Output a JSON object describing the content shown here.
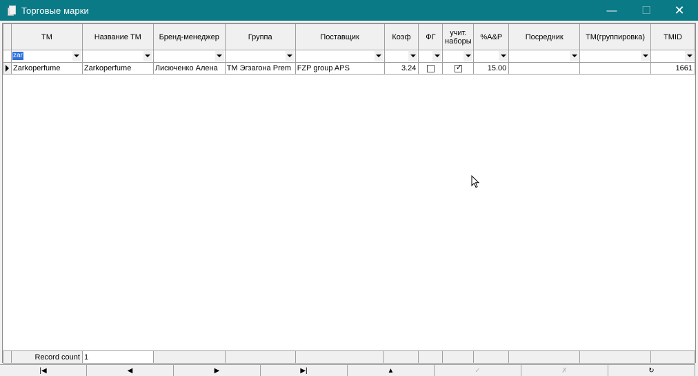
{
  "window": {
    "title": "Торговые марки",
    "minimize_glyph": "—",
    "maximize_glyph": "☐",
    "close_glyph": "✕"
  },
  "grid": {
    "columns": [
      {
        "key": "tm",
        "label": "ТМ"
      },
      {
        "key": "name_tm",
        "label": "Название ТМ"
      },
      {
        "key": "brand_manager",
        "label": "Бренд-менеджер"
      },
      {
        "key": "group",
        "label": "Группа"
      },
      {
        "key": "supplier",
        "label": "Поставщик"
      },
      {
        "key": "coef",
        "label": "Коэф"
      },
      {
        "key": "fg",
        "label": "ФГ"
      },
      {
        "key": "sets",
        "label": "учит. наборы"
      },
      {
        "key": "ap",
        "label": "%А&Р"
      },
      {
        "key": "intermediary",
        "label": "Посредник"
      },
      {
        "key": "tm_grouping",
        "label": "ТМ(группировка)"
      },
      {
        "key": "tmid",
        "label": "TMID"
      }
    ],
    "filters": {
      "tm": "zar",
      "name_tm": "",
      "brand_manager": "",
      "group": "",
      "supplier": "",
      "coef": "",
      "fg": "",
      "sets": "",
      "ap": "",
      "intermediary": "",
      "tm_grouping": "",
      "tmid": ""
    },
    "rows": [
      {
        "tm": "Zarkoperfume",
        "name_tm": "Zarkoperfume",
        "brand_manager": "Лисюченко Алена",
        "group": "ТМ Эгзагона Prem",
        "supplier": "FZP group APS",
        "coef": "3.24",
        "fg": false,
        "sets": true,
        "ap": "15.00",
        "intermediary": "",
        "tm_grouping": "",
        "tmid": "1661"
      }
    ]
  },
  "footer": {
    "record_count_label": "Record count",
    "record_count_value": "1"
  },
  "navigator": [
    {
      "name": "nav-first-button",
      "glyph": "|◀",
      "enabled": true
    },
    {
      "name": "nav-prior-button",
      "glyph": "◀",
      "enabled": true
    },
    {
      "name": "nav-next-button",
      "glyph": "▶",
      "enabled": true
    },
    {
      "name": "nav-last-button",
      "glyph": "▶|",
      "enabled": true
    },
    {
      "name": "nav-insert-button",
      "glyph": "▲",
      "enabled": true
    },
    {
      "name": "nav-post-button",
      "glyph": "✓",
      "enabled": false
    },
    {
      "name": "nav-cancel-button",
      "glyph": "✗",
      "enabled": false
    },
    {
      "name": "nav-refresh-button",
      "glyph": "↻",
      "enabled": true
    }
  ]
}
